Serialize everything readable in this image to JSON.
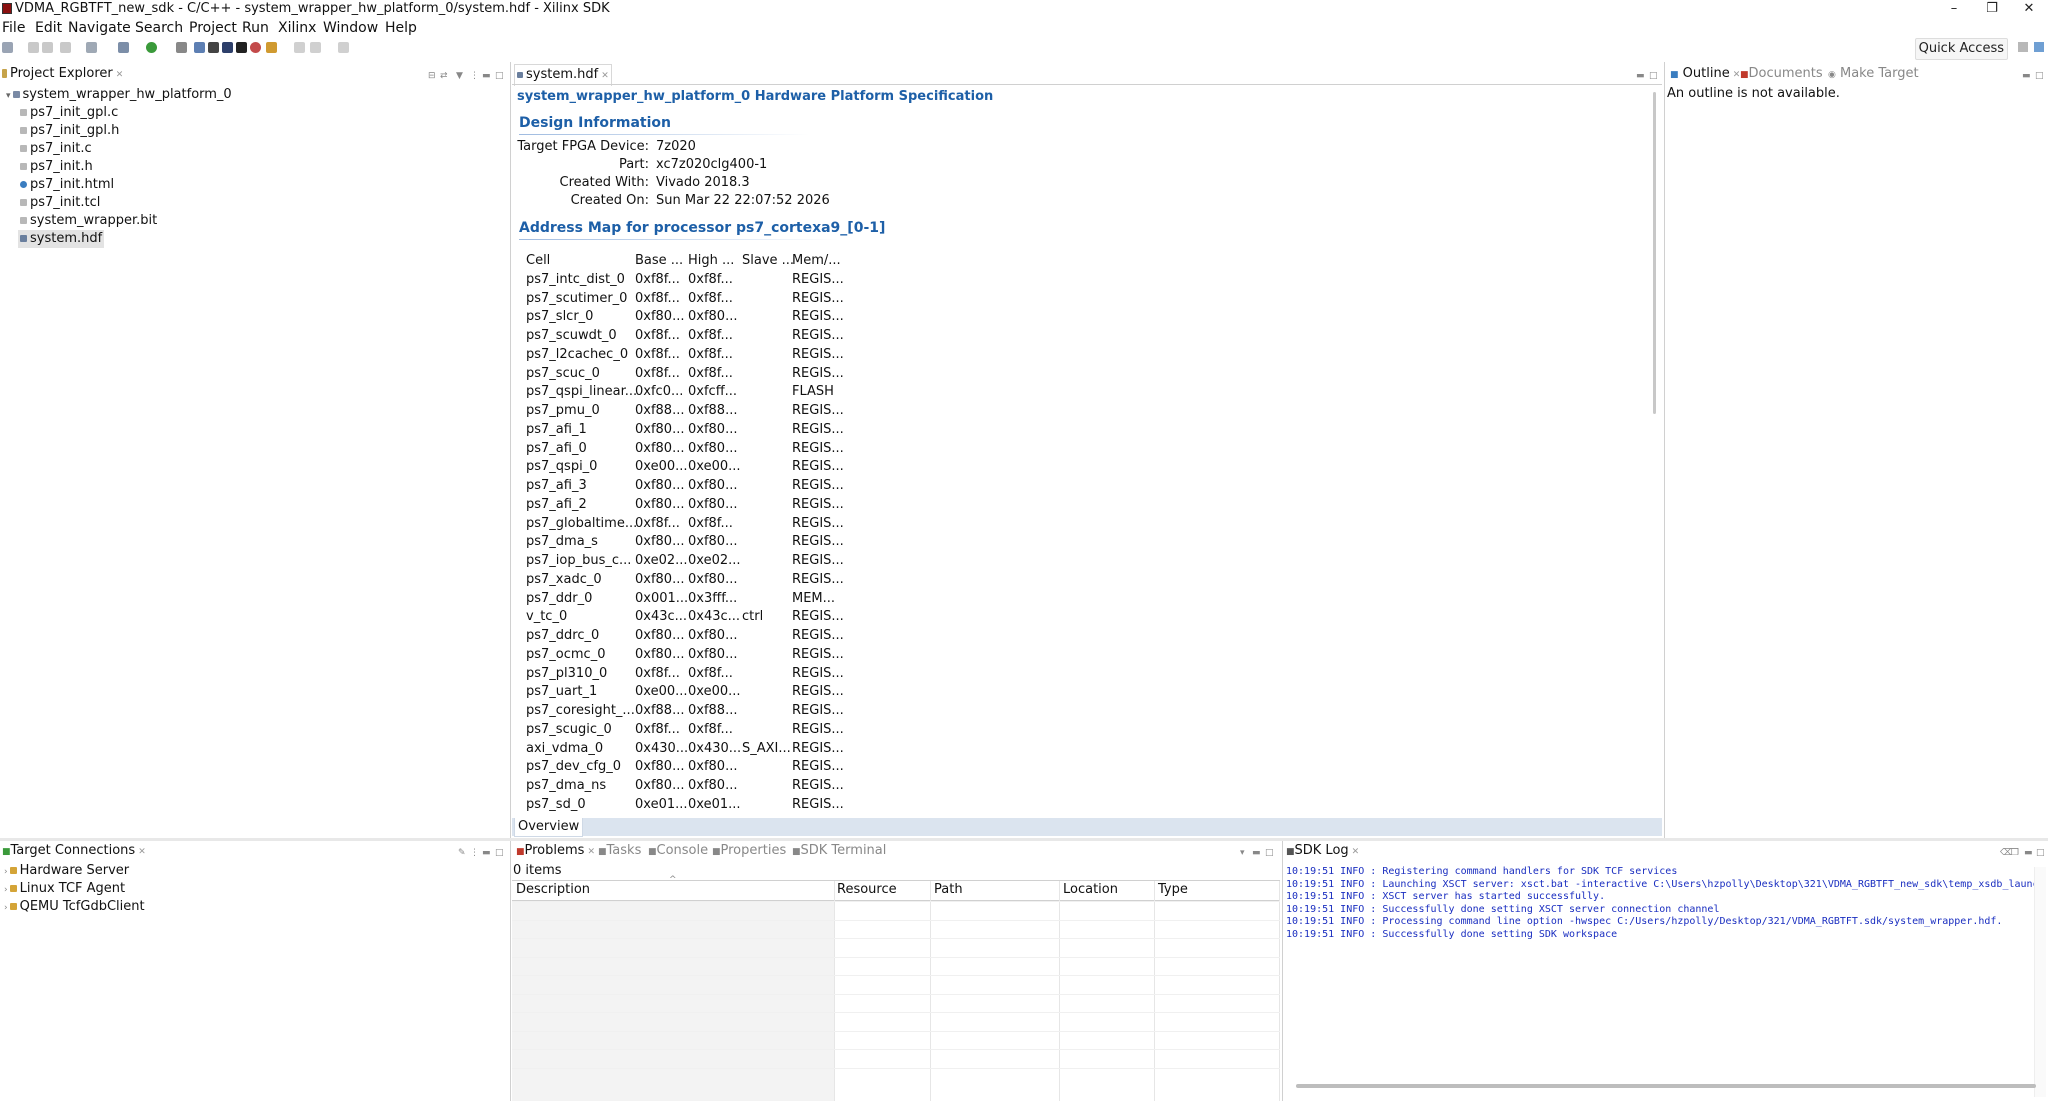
{
  "window": {
    "title": "VDMA_RGBTFT_new_sdk - C/C++ - system_wrapper_hw_platform_0/system.hdf - Xilinx SDK",
    "minimize": "–",
    "restore": "❐",
    "close": "✕"
  },
  "menu": [
    "File",
    "Edit",
    "Navigate",
    "Search",
    "Project",
    "Run",
    "Xilinx",
    "Window",
    "Help"
  ],
  "quick_access": "Quick Access",
  "project_explorer": {
    "tab": "Project Explorer",
    "root": "system_wrapper_hw_platform_0",
    "files": [
      "ps7_init_gpl.c",
      "ps7_init_gpl.h",
      "ps7_init.c",
      "ps7_init.h",
      "ps7_init.html",
      "ps7_init.tcl",
      "system_wrapper.bit",
      "system.hdf"
    ]
  },
  "editor": {
    "tab": "system.hdf",
    "heading": "system_wrapper_hw_platform_0 Hardware Platform Specification",
    "design_info_title": "Design Information",
    "design_info": [
      {
        "label": "Target FPGA Device:",
        "value": "7z020"
      },
      {
        "label": "Part:",
        "value": "xc7z020clg400-1"
      },
      {
        "label": "Created With:",
        "value": "Vivado 2018.3"
      },
      {
        "label": "Created On:",
        "value": "Sun Mar 22 22:07:52 2026"
      }
    ],
    "address_map_title": "Address Map for processor ps7_cortexa9_[0-1]",
    "columns": [
      "Cell",
      "Base ...",
      "High ...",
      "Slave ...",
      "Mem/..."
    ],
    "rows": [
      [
        "ps7_intc_dist_0",
        "0xf8f...",
        "0xf8f...",
        "",
        "REGIS..."
      ],
      [
        "ps7_scutimer_0",
        "0xf8f...",
        "0xf8f...",
        "",
        "REGIS..."
      ],
      [
        "ps7_slcr_0",
        "0xf80...",
        "0xf80...",
        "",
        "REGIS..."
      ],
      [
        "ps7_scuwdt_0",
        "0xf8f...",
        "0xf8f...",
        "",
        "REGIS..."
      ],
      [
        "ps7_l2cachec_0",
        "0xf8f...",
        "0xf8f...",
        "",
        "REGIS..."
      ],
      [
        "ps7_scuc_0",
        "0xf8f...",
        "0xf8f...",
        "",
        "REGIS..."
      ],
      [
        "ps7_qspi_linear...",
        "0xfc0...",
        "0xfcff...",
        "",
        "FLASH"
      ],
      [
        "ps7_pmu_0",
        "0xf88...",
        "0xf88...",
        "",
        "REGIS..."
      ],
      [
        "ps7_afi_1",
        "0xf80...",
        "0xf80...",
        "",
        "REGIS..."
      ],
      [
        "ps7_afi_0",
        "0xf80...",
        "0xf80...",
        "",
        "REGIS..."
      ],
      [
        "ps7_qspi_0",
        "0xe00...",
        "0xe00...",
        "",
        "REGIS..."
      ],
      [
        "ps7_afi_3",
        "0xf80...",
        "0xf80...",
        "",
        "REGIS..."
      ],
      [
        "ps7_afi_2",
        "0xf80...",
        "0xf80...",
        "",
        "REGIS..."
      ],
      [
        "ps7_globaltime...",
        "0xf8f...",
        "0xf8f...",
        "",
        "REGIS..."
      ],
      [
        "ps7_dma_s",
        "0xf80...",
        "0xf80...",
        "",
        "REGIS..."
      ],
      [
        "ps7_iop_bus_c...",
        "0xe02...",
        "0xe02...",
        "",
        "REGIS..."
      ],
      [
        "ps7_xadc_0",
        "0xf80...",
        "0xf80...",
        "",
        "REGIS..."
      ],
      [
        "ps7_ddr_0",
        "0x001...",
        "0x3fff...",
        "",
        "MEM..."
      ],
      [
        "v_tc_0",
        "0x43c...",
        "0x43c...",
        "ctrl",
        "REGIS..."
      ],
      [
        "ps7_ddrc_0",
        "0xf80...",
        "0xf80...",
        "",
        "REGIS..."
      ],
      [
        "ps7_ocmc_0",
        "0xf80...",
        "0xf80...",
        "",
        "REGIS..."
      ],
      [
        "ps7_pl310_0",
        "0xf8f...",
        "0xf8f...",
        "",
        "REGIS..."
      ],
      [
        "ps7_uart_1",
        "0xe00...",
        "0xe00...",
        "",
        "REGIS..."
      ],
      [
        "ps7_coresight_...",
        "0xf88...",
        "0xf88...",
        "",
        "REGIS..."
      ],
      [
        "ps7_scugic_0",
        "0xf8f...",
        "0xf8f...",
        "",
        "REGIS..."
      ],
      [
        "axi_vdma_0",
        "0x430...",
        "0x430...",
        "S_AXI...",
        "REGIS..."
      ],
      [
        "ps7_dev_cfg_0",
        "0xf80...",
        "0xf80...",
        "",
        "REGIS..."
      ],
      [
        "ps7_dma_ns",
        "0xf80...",
        "0xf80...",
        "",
        "REGIS..."
      ],
      [
        "ps7_sd_0",
        "0xe01...",
        "0xe01...",
        "",
        "REGIS..."
      ]
    ],
    "bottom_tab": "Overview"
  },
  "outline": {
    "tabs": [
      "Outline",
      "Documents",
      "Make Target"
    ],
    "message": "An outline is not available."
  },
  "target_connections": {
    "tab": "Target Connections",
    "items": [
      "Hardware Server",
      "Linux TCF Agent",
      "QEMU TcfGdbClient"
    ]
  },
  "problems": {
    "tabs": [
      "Problems",
      "Tasks",
      "Console",
      "Properties",
      "SDK Terminal"
    ],
    "count": "0 items",
    "columns": [
      "Description",
      "Resource",
      "Path",
      "Location",
      "Type"
    ]
  },
  "sdk_log": {
    "tab": "SDK Log",
    "lines": [
      "10:19:51 INFO   : Registering command handlers for SDK TCF services",
      "10:19:51 INFO   : Launching XSCT server: xsct.bat -interactive C:\\Users\\hzpolly\\Desktop\\321\\VDMA_RGBTFT_new_sdk\\temp_xsdb_launc",
      "10:19:51 INFO   : XSCT server has started successfully.",
      "10:19:51 INFO   : Successfully done setting XSCT server connection channel",
      "10:19:51 INFO   : Processing command line option -hwspec C:/Users/hzpolly/Desktop/321/VDMA_RGBTFT.sdk/system_wrapper.hdf.",
      "10:19:51 INFO   : Successfully done setting SDK workspace"
    ]
  }
}
